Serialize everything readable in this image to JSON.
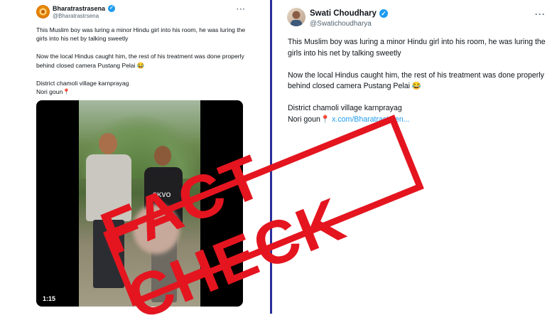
{
  "left_tweet": {
    "display_name": "Bharatrastrasena",
    "handle": "@Bharatrastrsena",
    "more_label": "···",
    "paragraph1": "This Muslim boy was luring a minor Hindu girl into his room, he was luring the girls into his net by talking sweetly",
    "paragraph2": "Now the local Hindus caught him, the rest of his treatment was done properly behind closed camera Pustang Pelai 😂",
    "line_location": "District chamoli village karnprayag",
    "line_village": "Nori goun",
    "pin_glyph": "📍",
    "video_duration": "1:15",
    "shirt_text": "SKVO"
  },
  "right_tweet": {
    "display_name": "Swati Choudhary",
    "handle": "@Swatichoudharya",
    "more_label": "···",
    "paragraph1": "This Muslim boy was luring a minor Hindu girl into his room, he was luring the girls into his net by talking sweetly",
    "paragraph2": "Now the local Hindus caught him, the rest of his treatment was done properly behind closed camera Pustang Pelai 😂",
    "line_location": "District chamoli village karnprayag",
    "line_village": "Nori goun",
    "pin_glyph": "📍",
    "link_text": "x.com/Bharatrastrsen..."
  },
  "stamp": {
    "text": "FACT CHECK",
    "color": "#e4151f"
  },
  "colors": {
    "divider": "#2a2f9a",
    "verified": "#1d9bf0",
    "link": "#1d9bf0"
  },
  "icons": {
    "verified": "verified-badge-icon",
    "pin": "location-pin-icon"
  }
}
